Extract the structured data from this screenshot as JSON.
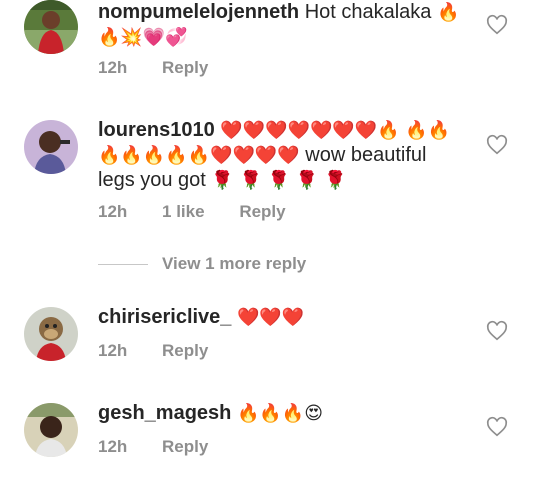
{
  "comments": [
    {
      "username": "nompumelelojenneth",
      "text": "Hot chakalaka",
      "emojis": "🔥 🔥💥💗💞",
      "time": "12h",
      "likes": "",
      "reply_label": "Reply",
      "avatar_icon": "user-photo-red-shirt"
    },
    {
      "username": "lourens1010",
      "text_emojis_1": "❤️❤️❤️❤️❤️❤️❤️🔥",
      "text_emojis_2": "🔥🔥🔥🔥🔥🔥🔥❤️❤️❤️❤️",
      "text": "wow beautiful legs you got",
      "text_emojis_3": "🌹 🌹 🌹 🌹 🌹",
      "time": "12h",
      "likes": "1 like",
      "reply_label": "Reply",
      "avatar_icon": "user-photo-selfie"
    },
    {
      "username": "chirisericlive_",
      "text": "",
      "emojis": "❤️❤️❤️",
      "time": "12h",
      "likes": "",
      "reply_label": "Reply",
      "avatar_icon": "ape-nft-avatar"
    },
    {
      "username": "gesh_magesh",
      "text": "",
      "emojis": "🔥🔥🔥😍",
      "time": "12h",
      "likes": "",
      "reply_label": "Reply",
      "avatar_icon": "user-photo-outdoor"
    }
  ],
  "view_more_replies": "View 1 more reply",
  "like_icon": "heart-outline-icon",
  "colors": {
    "text": "#262626",
    "muted": "#8e8e8e",
    "heart_red": "#e0245e"
  }
}
